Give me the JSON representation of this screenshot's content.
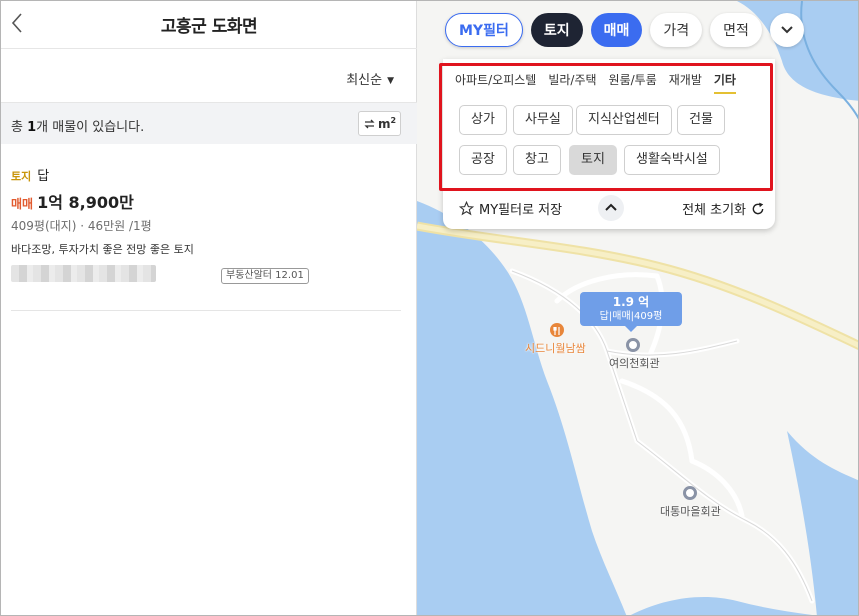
{
  "header": {
    "title": "고흥군 도화면"
  },
  "sort": {
    "label": "최신순"
  },
  "count": {
    "prefix": "총 ",
    "number": "1",
    "suffix": "개 매물이 있습니다."
  },
  "unit_toggle": {
    "label": "m",
    "sup": "2"
  },
  "listing": {
    "type_tag": "토지",
    "category": "답",
    "deal_tag": "매매",
    "price": "1억 8,900만",
    "detail": "409평(대지) · 46만원 /1평",
    "description": "바다조망, 투자가치 좋은 전망 좋은 토지",
    "source": "부동산알터 12.01"
  },
  "chips": {
    "my_filter": "MY필터",
    "land": "토지",
    "sale": "매매",
    "price": "가격",
    "area": "면적"
  },
  "filter_panel": {
    "tabs": [
      "아파트/오피스텔",
      "빌라/주택",
      "원룸/투룸",
      "재개발",
      "기타"
    ],
    "options": [
      "상가",
      "사무실",
      "지식산업센터",
      "건물",
      "공장",
      "창고",
      "토지",
      "생활숙박시설"
    ],
    "selected": "토지",
    "save_label": "MY필터로 저장",
    "reset_label": "전체 초기화"
  },
  "map": {
    "marker_price": "1.9 억",
    "marker_desc": "답|매매|409평",
    "poi_restaurant": "시드니월남쌈",
    "poi_hall1": "여의천회관",
    "poi_hall2": "대통마을회관"
  },
  "colors": {
    "accent_blue": "#3b6cf0",
    "dark_chip": "#1e2433",
    "deal_orange": "#e15a2e",
    "type_gold": "#c8950a",
    "highlight_red": "#e0141e",
    "sea": "#a9cdf2"
  }
}
